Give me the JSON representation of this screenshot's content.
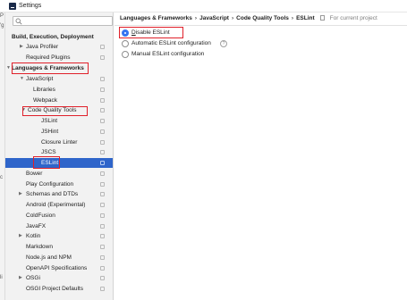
{
  "window": {
    "title": "Settings"
  },
  "edge_fragments": [
    "P",
    "'g",
    "c",
    "li"
  ],
  "sidebar": {
    "search": {
      "placeholder": "",
      "value": ""
    },
    "items": [
      {
        "label": "Build, Execution, Deployment",
        "bold": true,
        "arrow": ""
      },
      {
        "label": "Java Profiler",
        "arrow": "▶"
      },
      {
        "label": "Required Plugins",
        "arrow": ""
      },
      {
        "label": "Languages & Frameworks",
        "bold": true,
        "arrow": "▼"
      },
      {
        "label": "JavaScript",
        "arrow": "▼"
      },
      {
        "label": "Libraries",
        "arrow": ""
      },
      {
        "label": "Webpack",
        "arrow": ""
      },
      {
        "label": "Code Quality Tools",
        "arrow": "▼"
      },
      {
        "label": "JSLint",
        "arrow": ""
      },
      {
        "label": "JSHint",
        "arrow": ""
      },
      {
        "label": "Closure Linter",
        "arrow": ""
      },
      {
        "label": "JSCS",
        "arrow": ""
      },
      {
        "label": "ESLint",
        "arrow": "",
        "selected": true
      },
      {
        "label": "Bower",
        "arrow": ""
      },
      {
        "label": "Play Configuration",
        "arrow": ""
      },
      {
        "label": "Schemas and DTDs",
        "arrow": "▶"
      },
      {
        "label": "Android (Experimental)",
        "arrow": ""
      },
      {
        "label": "ColdFusion",
        "arrow": ""
      },
      {
        "label": "JavaFX",
        "arrow": ""
      },
      {
        "label": "Kotlin",
        "arrow": "▶"
      },
      {
        "label": "Markdown",
        "arrow": ""
      },
      {
        "label": "Node.js and NPM",
        "arrow": ""
      },
      {
        "label": "OpenAPI Specifications",
        "arrow": ""
      },
      {
        "label": "OSGi",
        "arrow": "▶"
      },
      {
        "label": "OSGI Project Defaults",
        "arrow": ""
      }
    ]
  },
  "main": {
    "breadcrumb": [
      "Languages & Frameworks",
      "JavaScript",
      "Code Quality Tools",
      "ESLint"
    ],
    "breadcrumb_separator": "›",
    "for_current_project": "For current project",
    "options": [
      {
        "label": "Disable ESLint",
        "checked": true,
        "mnemonic_index": 0
      },
      {
        "label": "Automatic ESLint configuration",
        "checked": false,
        "help": true
      },
      {
        "label": "Manual ESLint configuration",
        "checked": false
      }
    ]
  },
  "colors": {
    "selection": "#2f65ca",
    "highlight": "#e0202a",
    "radio_checked": "#3574f0",
    "sidebar_bg": "#f2f2f2"
  }
}
